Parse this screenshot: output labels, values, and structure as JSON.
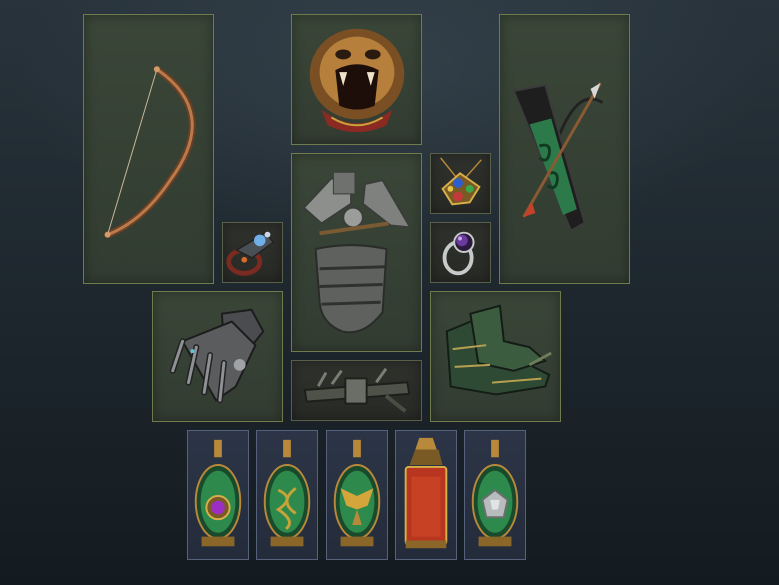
{
  "equipment": {
    "weapon_main": {
      "icon": "bow-icon"
    },
    "helmet": {
      "icon": "lion-head-helmet-icon"
    },
    "weapon_offhand": {
      "icon": "quiver-icon"
    },
    "body_armour": {
      "icon": "plate-armour-icon"
    },
    "amulet": {
      "icon": "jeweled-amulet-icon"
    },
    "ring_left": {
      "icon": "ornate-ring-icon"
    },
    "ring_right": {
      "icon": "amethyst-ring-icon"
    },
    "gloves": {
      "icon": "gauntlets-icon"
    },
    "belt": {
      "icon": "belt-icon"
    },
    "boots": {
      "icon": "boots-icon"
    }
  },
  "flasks": [
    {
      "icon": "flask-purple-gem-icon",
      "gem_color": "#9b2fc4"
    },
    {
      "icon": "flask-gold-knot-icon",
      "gem_color": "#c9a23a"
    },
    {
      "icon": "flask-winged-sigil-icon",
      "gem_color": "#d4a53a"
    },
    {
      "icon": "flask-red-bottle-icon",
      "gem_color": "#c9432a"
    },
    {
      "icon": "flask-silver-stone-icon",
      "gem_color": "#b8bcbc"
    }
  ],
  "colors": {
    "slot_fill": "#364132",
    "slot_border": "#6f7a4d",
    "flask_slot_fill": "#283040",
    "flask_liquid": "#2e8a4c",
    "gold_trim": "#b8893a"
  }
}
